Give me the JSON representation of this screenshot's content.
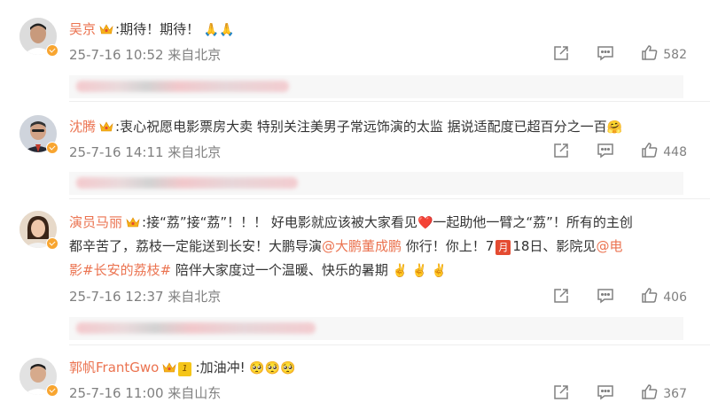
{
  "comments": [
    {
      "username": "吴京",
      "text": ":期待！期待！",
      "emoji": "🙏🙏",
      "time": "25-7-16 10:52 来自北京",
      "likes": "582",
      "reply_blurred": true
    },
    {
      "username": "沈腾",
      "text": ":衷心祝愿电影票房大卖  特别关注美男子常远饰演的太监  据说适配度已超百分之一百",
      "emoji": "🤗",
      "time": "25-7-16 14:11 来自北京",
      "likes": "448",
      "reply_blurred": true
    },
    {
      "username": "演员马丽",
      "line1_text": ":接“荔”接“荔”！！！  好电影就应该被大家看见",
      "line1_heart": "❤️",
      "line1_tail": "一起助他一臂之“荔”！所有的主创",
      "line2_text": "都辛苦了，荔枝一定能送到长安！大鹏导演",
      "line2_mention": "@大鹏董成鹏",
      "line2_mid": " 你行！你上！7",
      "line2_badge": "月",
      "line2_after": "18日、影院见",
      "line2_mention2": "@电",
      "line3_mention": "影",
      "line3_topic": "#长安的荔枝#",
      "line3_text": " 陪伴大家度过一个温暖、快乐的暑期",
      "line3_emoji": "✌️ ✌️ ✌️",
      "time": "25-7-16 12:37 来自北京",
      "likes": "406",
      "reply_blurred": true
    },
    {
      "username": "郭帆FrantGwo",
      "level": "1",
      "text": ":加油冲!",
      "emoji": "🥺🥺🥺",
      "time": "25-7-16 11:00 来自山东",
      "likes": "367"
    }
  ],
  "icons": {
    "share": "share-icon",
    "comment": "comment-icon",
    "like": "like-icon",
    "crown": "crown-icon",
    "verified": "verified-badge-icon"
  },
  "colors": {
    "username": "#eb7350",
    "link": "#eb7350",
    "meta": "#808080",
    "badge": "#f8a530"
  }
}
